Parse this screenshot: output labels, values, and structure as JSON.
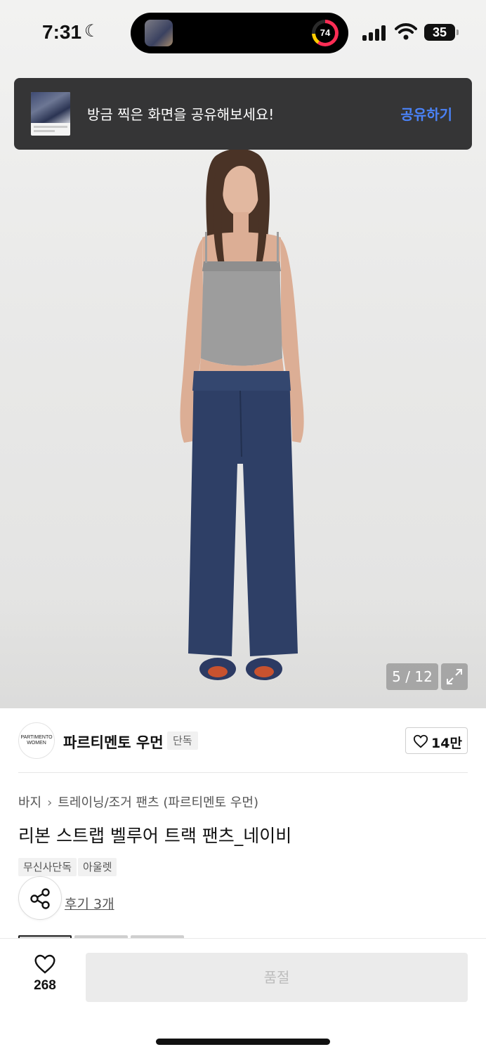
{
  "status_bar": {
    "time": "7:31",
    "activity_ring_value": "74",
    "battery_level": "35"
  },
  "toast": {
    "message": "방금 찍은 화면을 공유해보세요!",
    "action_label": "공유하기"
  },
  "gallery": {
    "counter": "5 / 12"
  },
  "brand": {
    "logo_text": "PARTIMENTO WOMEN",
    "name": "파르티멘토 우먼",
    "badge": "단독",
    "like_count": "14만"
  },
  "breadcrumb": {
    "category": "바지",
    "subcategory": "트레이닝/조거 팬츠 (파르티멘토 우먼)"
  },
  "product": {
    "title": "리본 스트랩 벨루어 트랙 팬츠_네이비",
    "tags": [
      "무신사단독",
      "아울렛"
    ],
    "review_link": "후기 3개"
  },
  "bottom_bar": {
    "wish_count": "268",
    "purchase_label": "품절"
  },
  "colors": {
    "toast_bg": "#353536",
    "toast_action": "#4a82f7",
    "soldout_bg": "#ebebeb",
    "pants_navy": "#2e3f66"
  }
}
